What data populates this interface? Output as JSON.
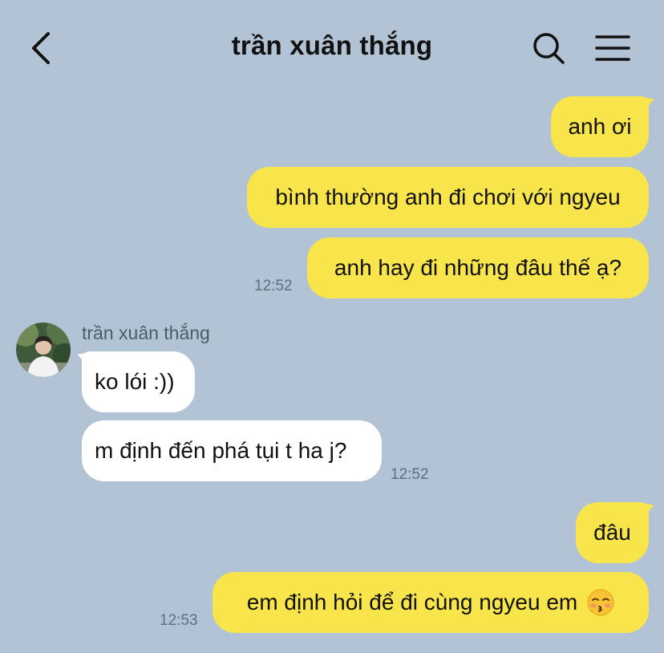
{
  "header": {
    "title": "trần xuân thắng",
    "back_icon": "chevron-left-icon",
    "search_icon": "search-icon",
    "menu_icon": "hamburger-menu-icon"
  },
  "colors": {
    "background": "#b1c3d4",
    "outgoing_bubble": "#f8e54b",
    "incoming_bubble": "#ffffff"
  },
  "conversation": {
    "outgoing_group_1": {
      "messages": [
        "anh ơi",
        "bình thường anh đi chơi với ngyeu",
        "anh hay đi những đâu thế ạ?"
      ],
      "time": "12:52"
    },
    "incoming_group": {
      "sender_name": "trần xuân thắng",
      "messages": [
        "ko lói :))",
        "m định đến phá tụi t ha j?"
      ],
      "time": "12:52"
    },
    "outgoing_group_2": {
      "messages": [
        "đâu",
        "em định hỏi để đi cùng ngyeu em"
      ],
      "emoji": "kissing-face-emoji",
      "time": "12:53"
    }
  }
}
